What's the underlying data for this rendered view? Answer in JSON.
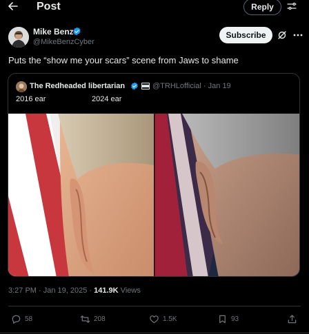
{
  "header": {
    "title": "Post",
    "reply_label": "Reply"
  },
  "author": {
    "name": "Mike Benz",
    "handle": "@MikeBenzCyber"
  },
  "actions_top": {
    "subscribe_label": "Subscribe"
  },
  "post": {
    "text": "Puts the “show me your scars” scene from Jaws to shame"
  },
  "quote": {
    "author_name": "The Redheaded libertarian",
    "handle_date": "@TRHLofficial · Jan 19",
    "caption_left": "2016 ear",
    "caption_right": "2024 ear"
  },
  "meta": {
    "timestamp": "3:27 PM · Jan 19, 2025 · ",
    "views_count": "141.9K",
    "views_label": " Views"
  },
  "stats": {
    "replies": "58",
    "reposts": "208",
    "likes": "1.5K",
    "bookmarks": "93"
  },
  "colors": {
    "background": "#000000",
    "text": "#e7e9ea",
    "muted": "#71767b",
    "border": "#2f3336",
    "verified": "#1d9bf0"
  },
  "icons": [
    "back-arrow-icon",
    "settings-icon",
    "verified-icon",
    "grok-icon",
    "more-icon",
    "flag-icon",
    "reply-icon",
    "repost-icon",
    "like-icon",
    "bookmark-icon",
    "share-icon"
  ]
}
